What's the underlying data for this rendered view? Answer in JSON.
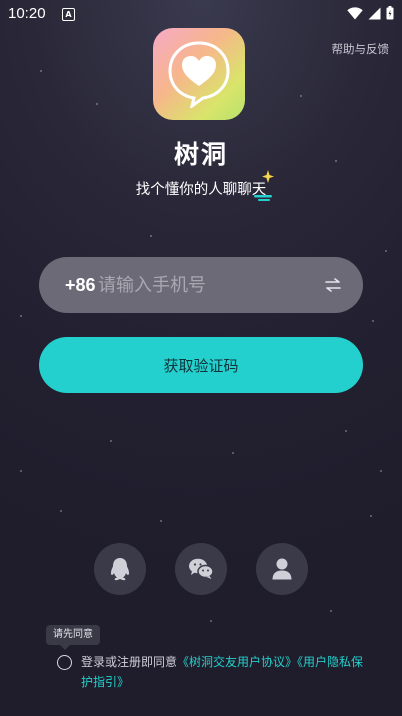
{
  "status_bar": {
    "time": "10:20",
    "indicator": "A"
  },
  "header": {
    "help_label": "帮助与反馈"
  },
  "brand": {
    "app_name": "树洞",
    "slogan": "找个懂你的人聊聊天"
  },
  "login": {
    "country_code": "+86",
    "phone_placeholder": "请输入手机号",
    "get_code_label": "获取验证码"
  },
  "social": {
    "items": [
      {
        "name": "qq",
        "icon": "qq-penguin-icon"
      },
      {
        "name": "wechat",
        "icon": "wechat-icon"
      },
      {
        "name": "account",
        "icon": "user-icon"
      }
    ]
  },
  "agreement": {
    "tooltip": "请先同意",
    "prefix": "登录或注册即同意",
    "user_agreement": "《树洞交友用户协议》",
    "privacy_policy": "《用户隐私保护指引》"
  },
  "colors": {
    "accent": "#23d0cd",
    "input_bg": "#6b6a76",
    "bg": "#232131"
  }
}
